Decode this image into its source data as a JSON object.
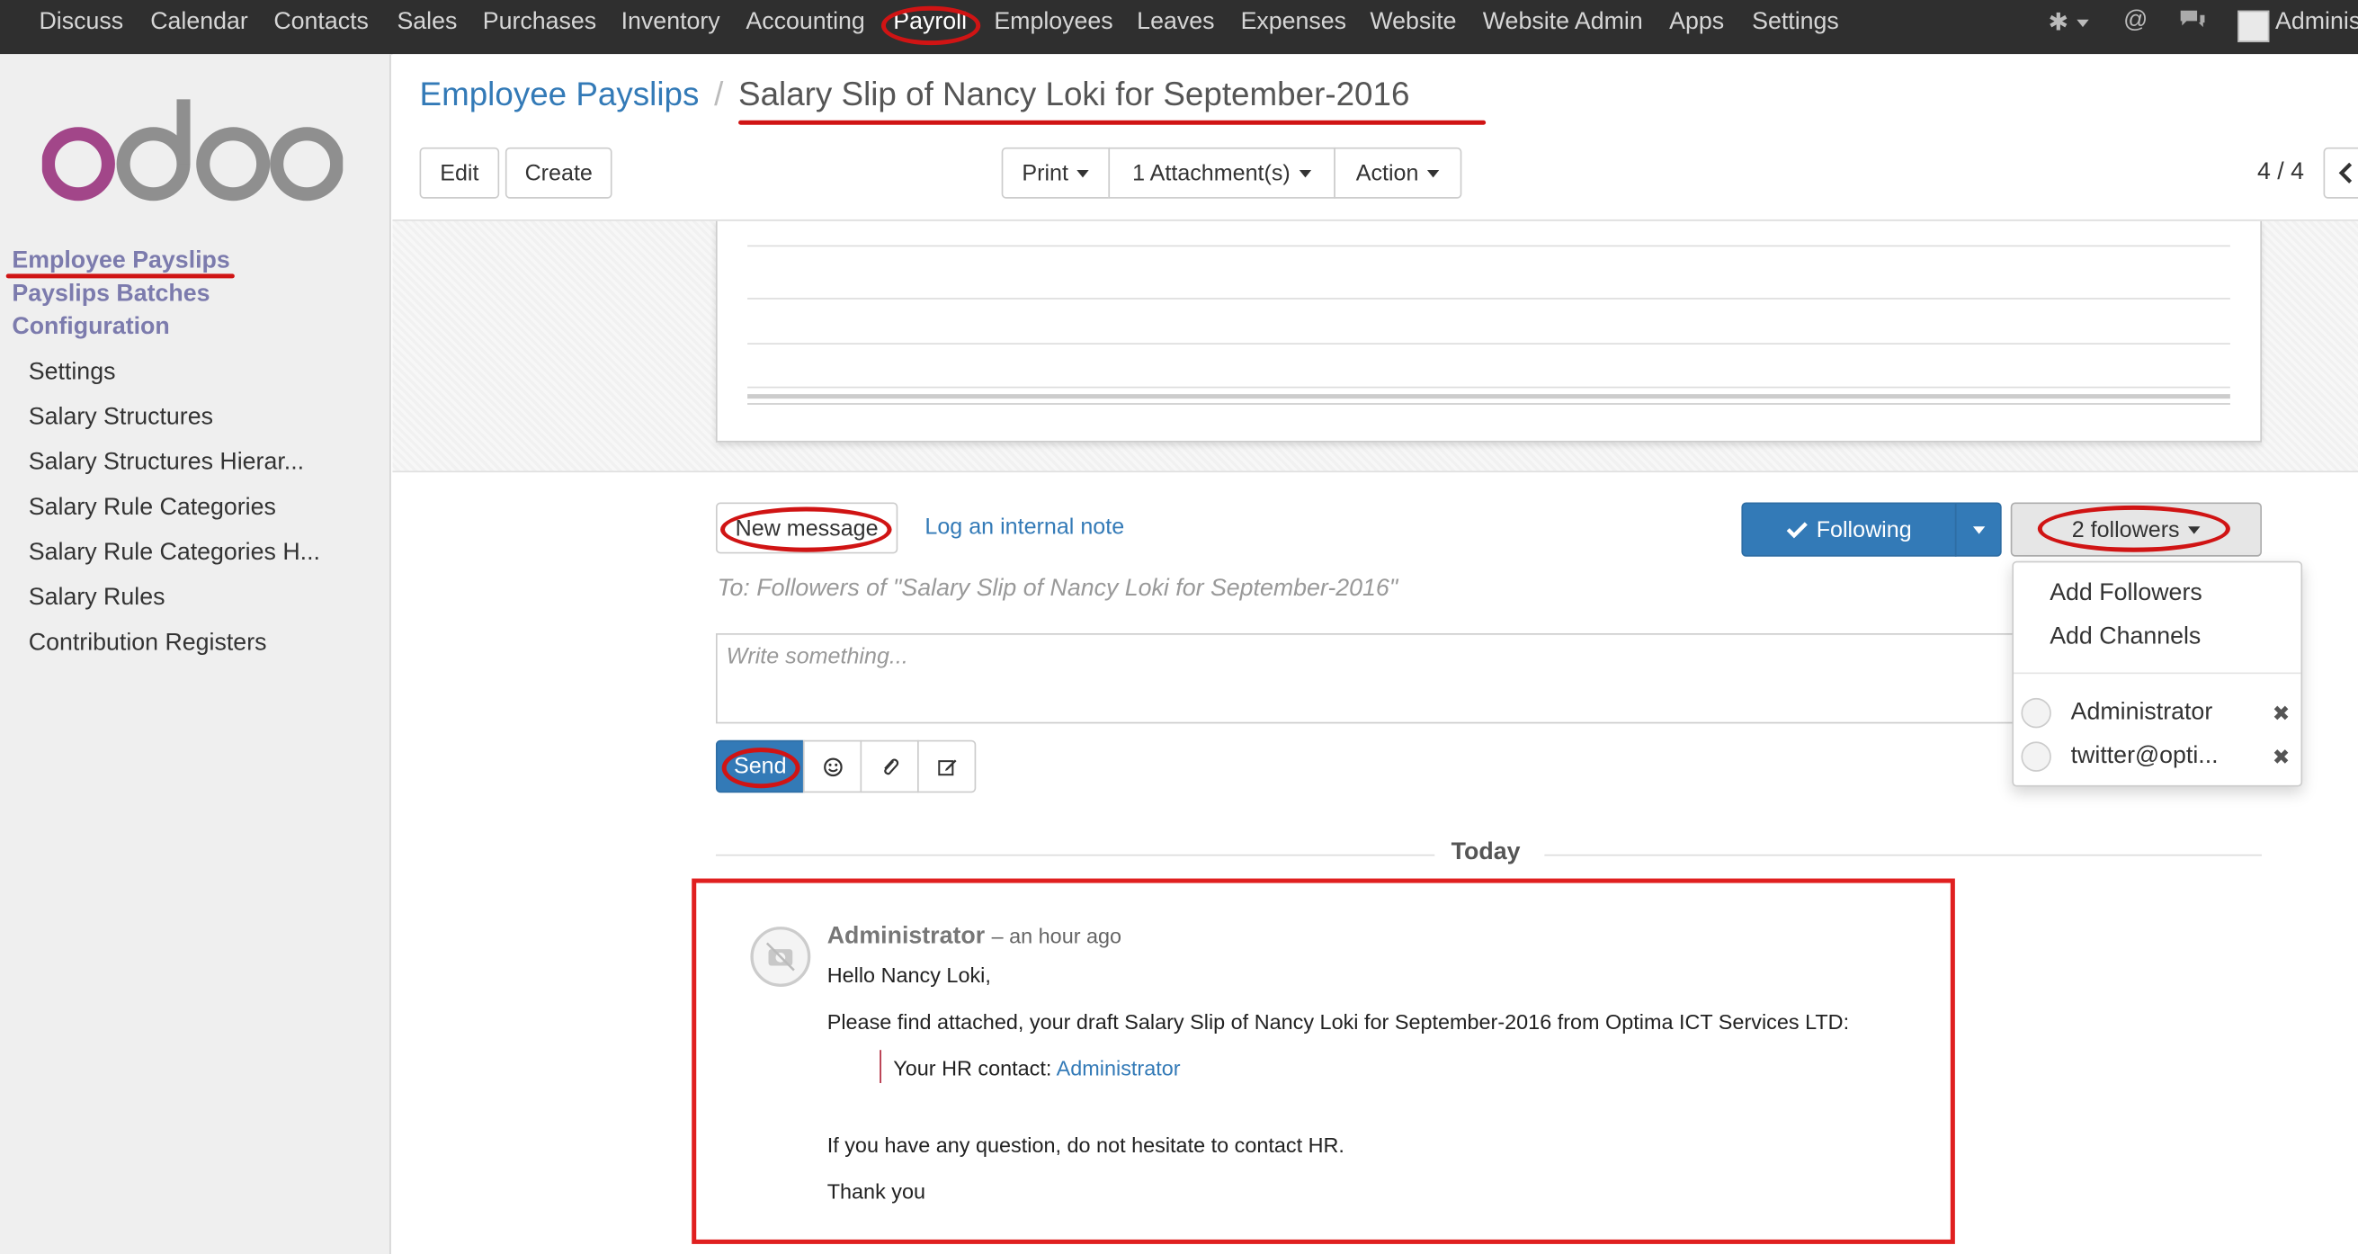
{
  "topbar": {
    "menu": [
      "Discuss",
      "Calendar",
      "Contacts",
      "Sales",
      "Purchases",
      "Inventory",
      "Accounting",
      "Payroll",
      "Employees",
      "Leaves",
      "Expenses",
      "Website",
      "Website Admin",
      "Apps",
      "Settings"
    ],
    "active": "Payroll",
    "user": "Adminis"
  },
  "sidebar": {
    "logo": "odoo",
    "sections": [
      "Employee Payslips",
      "Payslips Batches",
      "Configuration"
    ],
    "items": [
      "Settings",
      "Salary Structures",
      "Salary Structures Hierar...",
      "Salary Rule Categories",
      "Salary Rule Categories H...",
      "Salary Rules",
      "Contribution Registers"
    ]
  },
  "breadcrumb": {
    "parent": "Employee Payslips",
    "current": "Salary Slip of Nancy Loki for September-2016"
  },
  "toolbar": {
    "edit": "Edit",
    "create": "Create",
    "print": "Print",
    "attachments": "1 Attachment(s)",
    "action": "Action",
    "pager": "4 / 4"
  },
  "chatter": {
    "new_message": "New message",
    "log_note": "Log an internal note",
    "following": "Following",
    "followers": "2 followers",
    "to_line": "To: Followers of \"Salary Slip of Nancy Loki for September-2016\"",
    "placeholder": "Write something...",
    "send": "Send",
    "dropdown": {
      "add_followers": "Add Followers",
      "add_channels": "Add Channels",
      "followers": [
        "Administrator",
        "twitter@opti..."
      ]
    },
    "today": "Today",
    "message": {
      "author": "Administrator",
      "time": "– an hour ago",
      "greeting": "Hello Nancy Loki,",
      "body": "Please find attached, your draft Salary Slip of Nancy Loki for September-2016 from Optima ICT Services LTD:",
      "hr_contact_label": "Your HR contact:",
      "hr_contact_name": "Administrator",
      "question": "If you have any question, do not hesitate to contact HR.",
      "closing": "Thank you"
    }
  },
  "colors": {
    "annotation": "#d01414",
    "primary": "#337ab7",
    "sidebar_header": "#7c7bad"
  }
}
